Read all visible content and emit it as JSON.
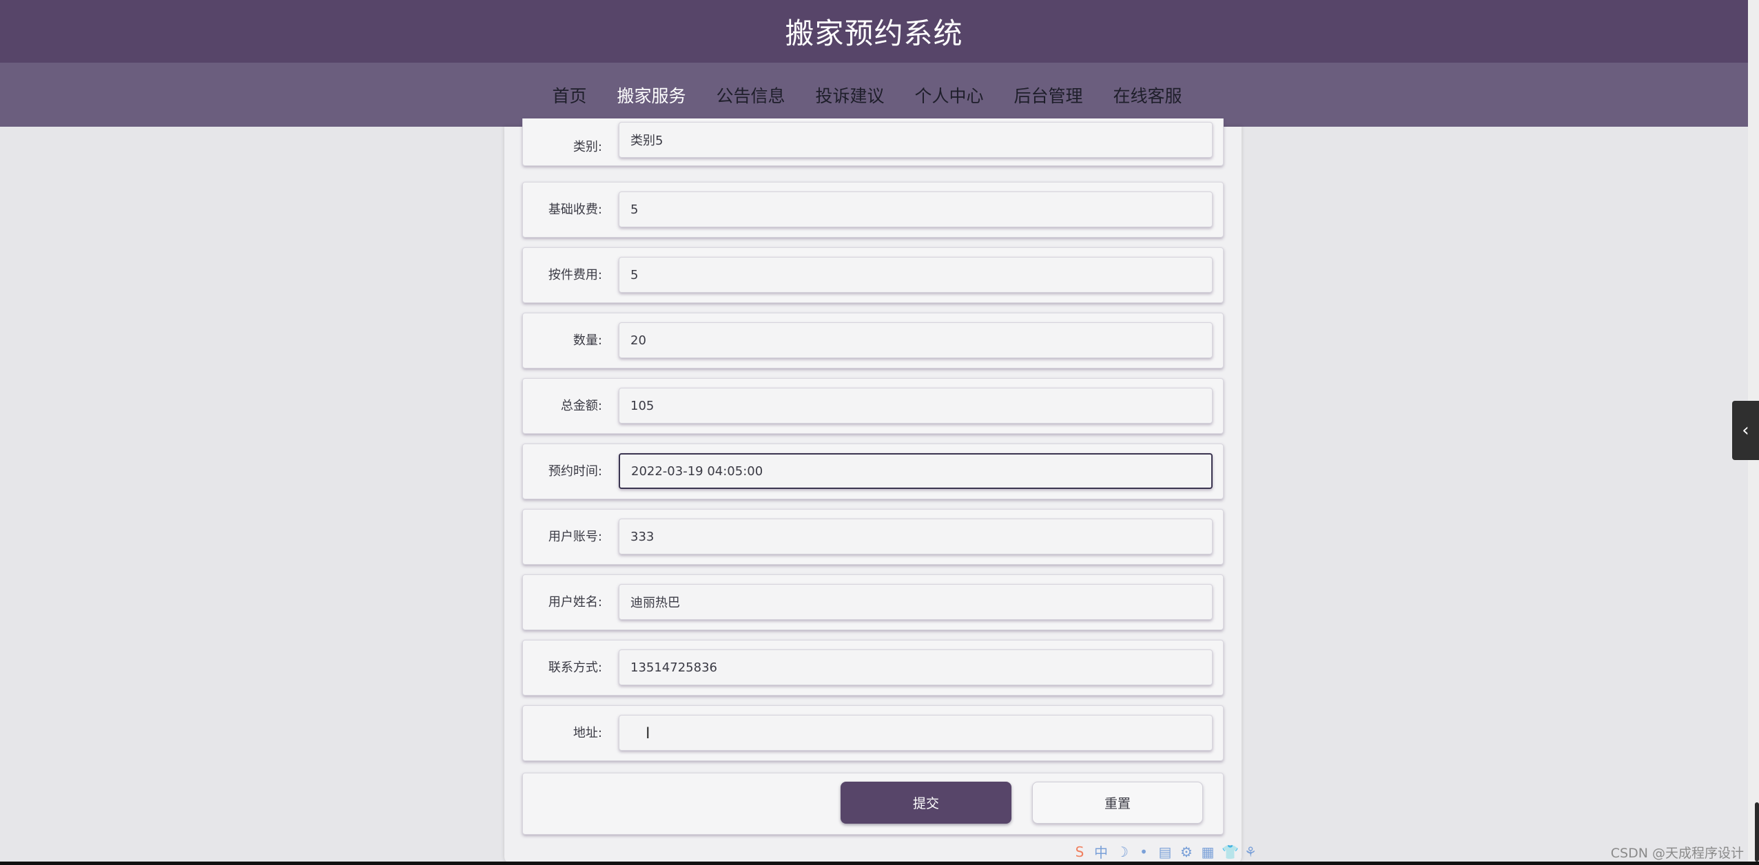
{
  "header": {
    "title": "搬家预约系统"
  },
  "nav": {
    "items": [
      {
        "label": "首页"
      },
      {
        "label": "搬家服务",
        "active": true
      },
      {
        "label": "公告信息"
      },
      {
        "label": "投诉建议"
      },
      {
        "label": "个人中心"
      },
      {
        "label": "后台管理"
      },
      {
        "label": "在线客服"
      }
    ]
  },
  "form": {
    "fields": [
      {
        "label": "类别:",
        "value": "类别5"
      },
      {
        "label": "基础收费:",
        "value": "5"
      },
      {
        "label": "按件费用:",
        "value": "5"
      },
      {
        "label": "数量:",
        "value": "20"
      },
      {
        "label": "总金额:",
        "value": "105"
      },
      {
        "label": "预约时间:",
        "value": "2022-03-19 04:05:00"
      },
      {
        "label": "用户账号:",
        "value": "333"
      },
      {
        "label": "用户姓名:",
        "value": "迪丽热巴"
      },
      {
        "label": "联系方式:",
        "value": "13514725836"
      },
      {
        "label": "地址:",
        "value": ""
      }
    ],
    "submit_label": "提交",
    "reset_label": "重置"
  },
  "side_tab": {
    "icon": "chevron-left-icon",
    "glyph": "‹"
  },
  "ime": {
    "items": [
      "S",
      "中",
      "☽",
      "•",
      "▤",
      "⚙",
      "▦",
      "👕",
      "⚘"
    ]
  },
  "watermark": "CSDN @天成程序设计",
  "colors": {
    "primary": "#574569",
    "nav": "#6b5e7e",
    "background": "#e6e6e9"
  }
}
